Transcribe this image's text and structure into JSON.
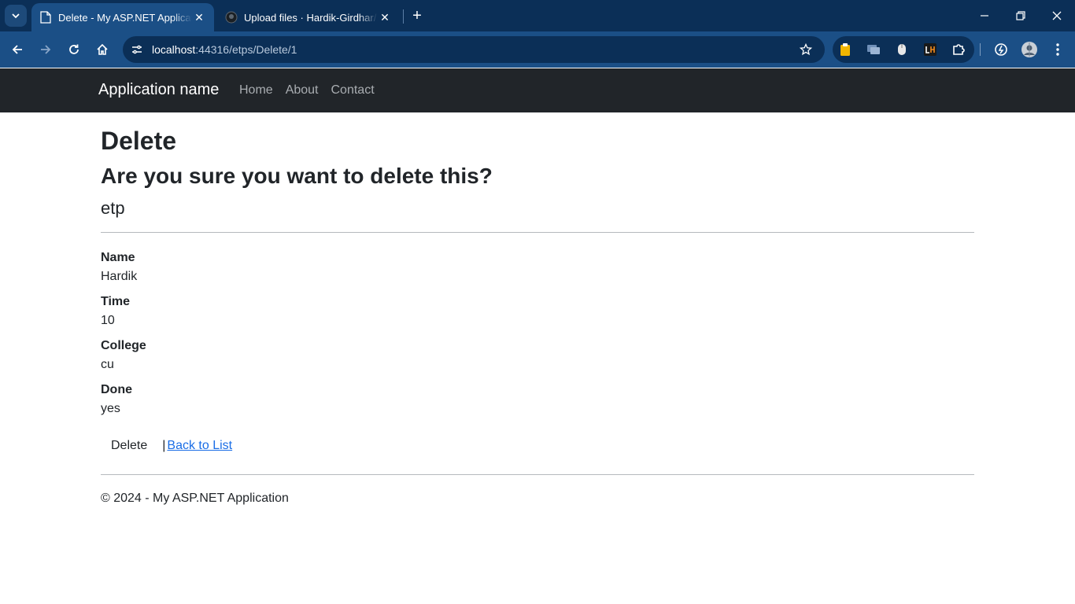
{
  "browser": {
    "tabs": [
      {
        "title": "Delete - My ASP.NET Application",
        "active": true
      },
      {
        "title": "Upload files · Hardik-Girdhar/.net",
        "active": false
      }
    ],
    "url": {
      "host": "localhost",
      "rest": ":44316/etps/Delete/1"
    },
    "colors": {
      "tabstrip": "#0b2f57",
      "toolbar": "#1b4f86"
    }
  },
  "navbar": {
    "brand": "Application name",
    "links": [
      "Home",
      "About",
      "Contact"
    ]
  },
  "page": {
    "heading": "Delete",
    "question": "Are you sure you want to delete this?",
    "entity": "etp",
    "fields": [
      {
        "label": "Name",
        "value": "Hardik"
      },
      {
        "label": "Time",
        "value": "10"
      },
      {
        "label": "College",
        "value": "cu"
      },
      {
        "label": "Done",
        "value": "yes"
      }
    ],
    "delete_label": "Delete",
    "separator": "|",
    "back_label": "Back to List"
  },
  "footer": {
    "text": "© 2024 - My ASP.NET Application"
  }
}
